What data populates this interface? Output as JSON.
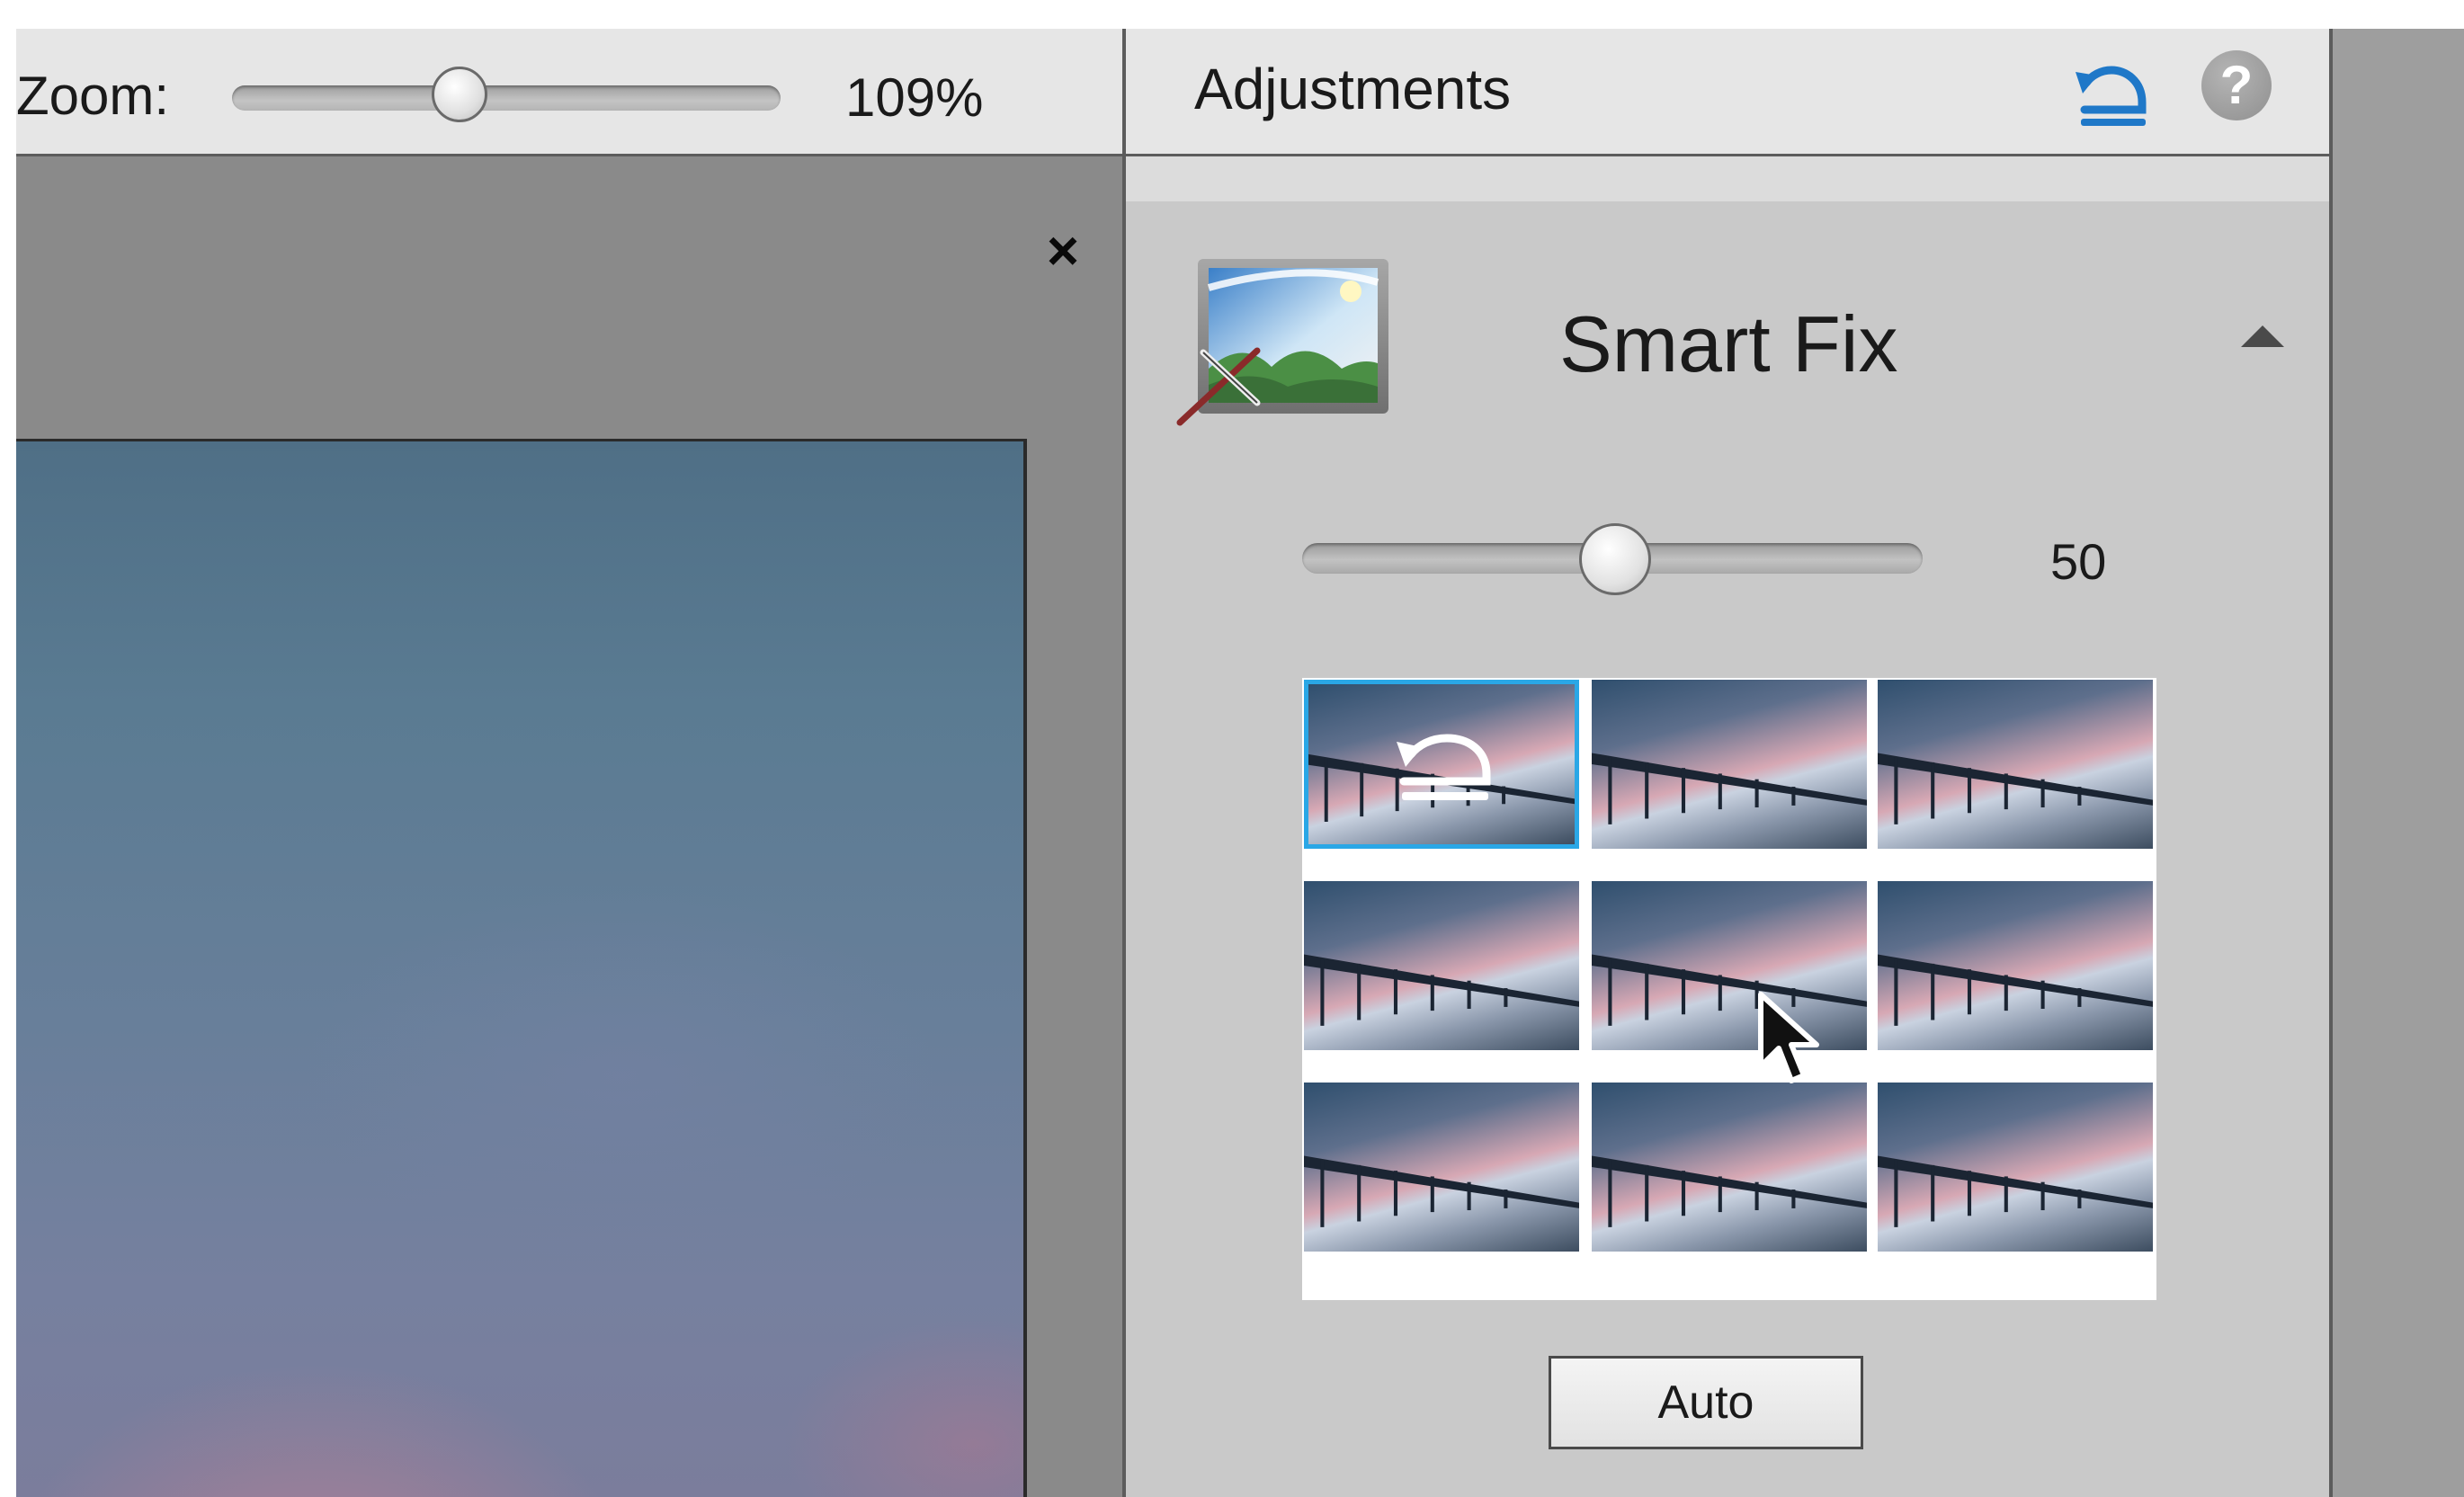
{
  "toolbar": {
    "zoom_label": "Zoom:",
    "zoom_value": "109%",
    "zoom_level_percent": 109
  },
  "canvas": {
    "close_label": "×"
  },
  "panel": {
    "title": "Adjustments",
    "help_label": "?",
    "section": {
      "title": "Smart Fix",
      "slider_value": "50",
      "slider_numeric": 50,
      "selected_thumbnail_index": 0,
      "thumbnail_count": 9,
      "auto_button_label": "Auto"
    }
  },
  "colors": {
    "selection_accent": "#2aa7e6",
    "reset_icon_blue": "#1f78c8",
    "panel_bg": "#c9c9c9",
    "toolbar_bg": "#e6e6e6",
    "canvas_bg": "#8a8a8a"
  },
  "icons": {
    "reset": "reset-icon",
    "help": "help-icon",
    "close": "close-icon",
    "collapse": "chevron-up-icon",
    "smart_fix": "smart-fix-icon"
  }
}
